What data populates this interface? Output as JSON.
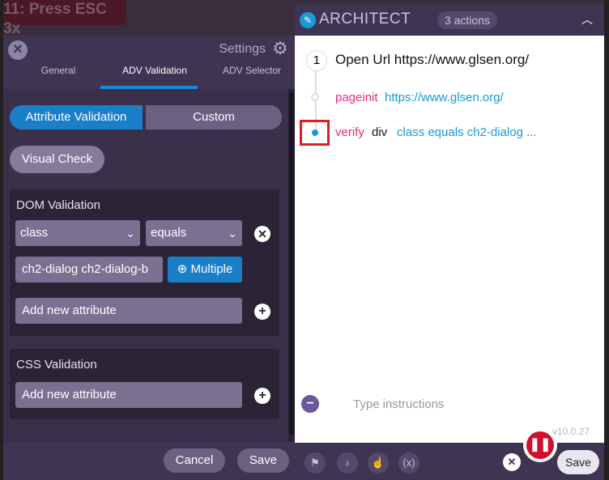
{
  "background": {
    "banner_text": "11: Press ESC 3x"
  },
  "settings": {
    "title": "Settings",
    "tabs": [
      "General",
      "ADV Validation",
      "ADV Selector"
    ],
    "segments": [
      "Attribute Validation",
      "Custom"
    ],
    "visual_check": "Visual Check",
    "dom_validation": {
      "title": "DOM Validation",
      "attribute_select": "class",
      "operator_select": "equals",
      "value_input": "ch2-dialog ch2-dialog-b",
      "multiple_label": "Multiple",
      "add_placeholder": "Add new attribute"
    },
    "css_validation": {
      "title": "CSS Validation",
      "add_placeholder": "Add new attribute"
    },
    "cancel_label": "Cancel",
    "save_label": "Save"
  },
  "architect": {
    "title": "ARCHITECT",
    "count": "3 actions",
    "steps": [
      {
        "num": "1",
        "text": "Open Url https://www.glsen.org/"
      },
      {
        "keyword": "pageinit",
        "value": "https://www.glsen.org/"
      },
      {
        "keyword": "verify",
        "target": "div",
        "value": "class equals ch2-dialog ..."
      }
    ],
    "instructions_placeholder": "Type instructions",
    "version": "v10.0.27",
    "save_label": "Save",
    "footer_icons": [
      "flag-icon",
      "pin-icon",
      "cursor-icon",
      "variable-icon"
    ]
  },
  "colors": {
    "accent": "#1a7fc9",
    "keyword": "#e0307a",
    "value": "#1a9ad6",
    "record": "#d0102a",
    "highlight": "#e01b24"
  }
}
